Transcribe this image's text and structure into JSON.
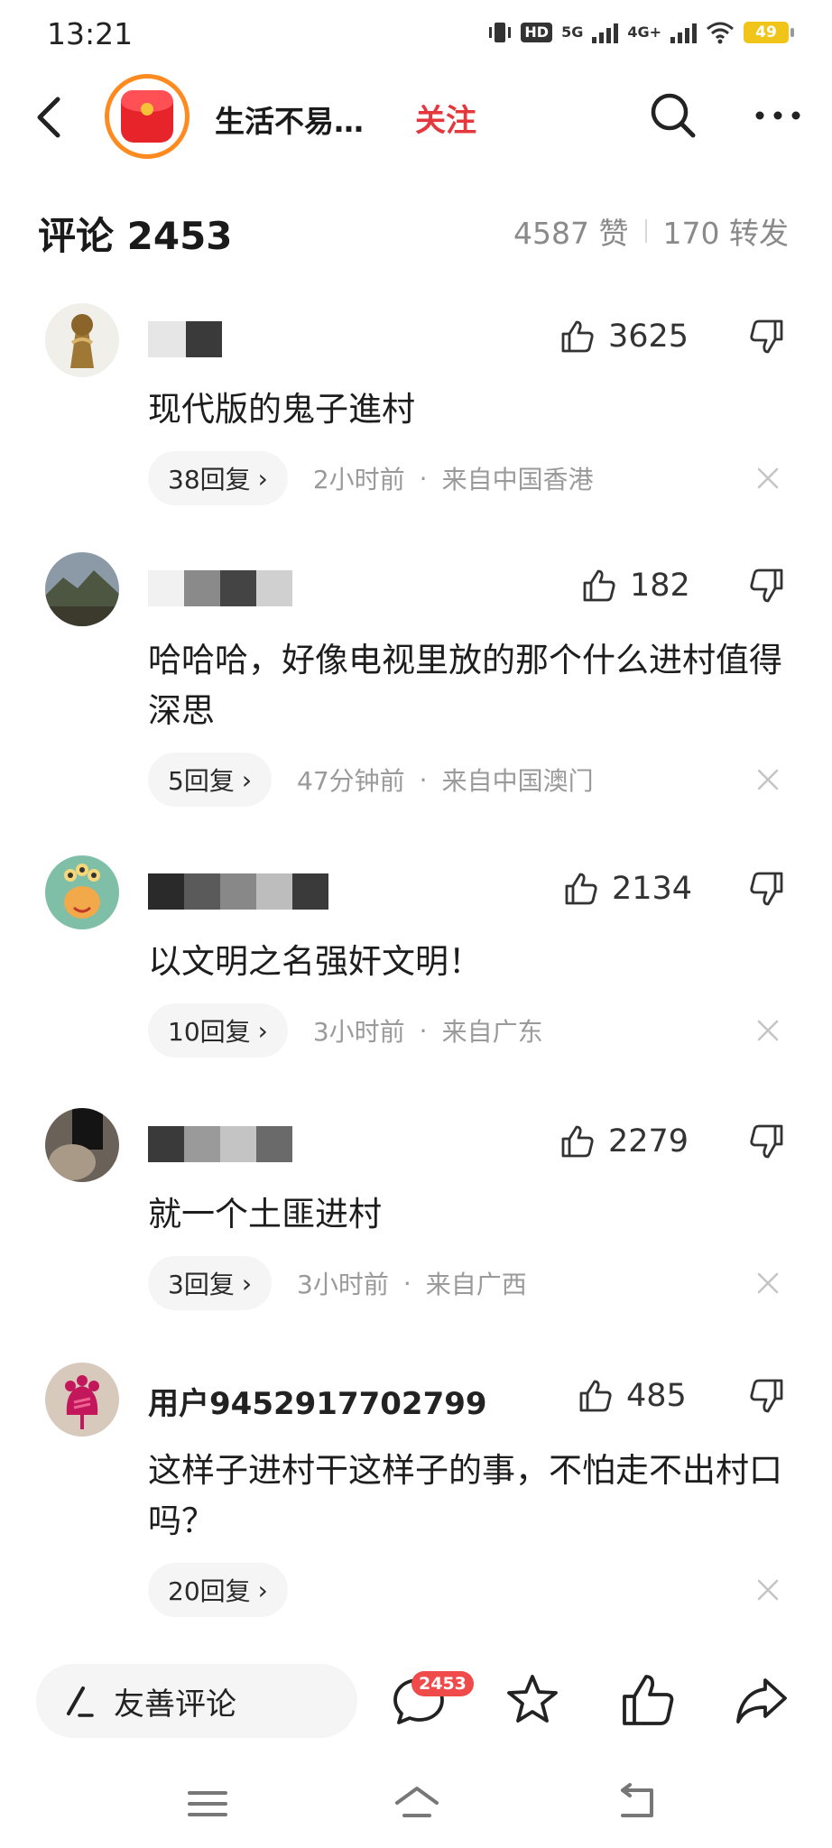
{
  "status_bar": {
    "time": "13:21",
    "hd_label": "HD",
    "net_5g": "5G",
    "net_4g": "4G+",
    "battery": "49"
  },
  "header": {
    "title": "生活不易…",
    "follow_label": "关注",
    "accent_color": "#e5383d"
  },
  "comments_header": {
    "title": "评论 2453",
    "likes": "4587 赞",
    "reposts": "170 转发"
  },
  "comments": [
    {
      "name": "",
      "likes": "3625",
      "text": "现代版的鬼子進村",
      "replies": "38回复",
      "time": "2小时前",
      "location": "来自中国香港"
    },
    {
      "name": "",
      "likes": "182",
      "text": "哈哈哈，好像电视里放的那个什么进村值得深思",
      "replies": "5回复",
      "time": "47分钟前",
      "location": "来自中国澳门"
    },
    {
      "name": "",
      "likes": "2134",
      "text": "以文明之名强奸文明！",
      "replies": "10回复",
      "time": "3小时前",
      "location": "来自广东"
    },
    {
      "name": "",
      "likes": "2279",
      "text": "就一个土匪进村",
      "replies": "3回复",
      "time": "3小时前",
      "location": "来自广西"
    },
    {
      "name": "用户9452917702799",
      "likes": "485",
      "text": "这样子进村干这样子的事，不怕走不出村口吗？",
      "replies": "20回复",
      "time": "",
      "location": ""
    }
  ],
  "bottom_bar": {
    "compose_label": "友善评论",
    "comment_badge": "2453"
  },
  "icons": [
    "back-icon",
    "search-icon",
    "more-icon",
    "thumb-up-icon",
    "thumb-down-icon",
    "chevron-right-icon",
    "close-icon",
    "pen-icon",
    "comment-icon",
    "star-icon",
    "share-icon",
    "menu-icon",
    "home-icon",
    "back-nav-icon"
  ]
}
